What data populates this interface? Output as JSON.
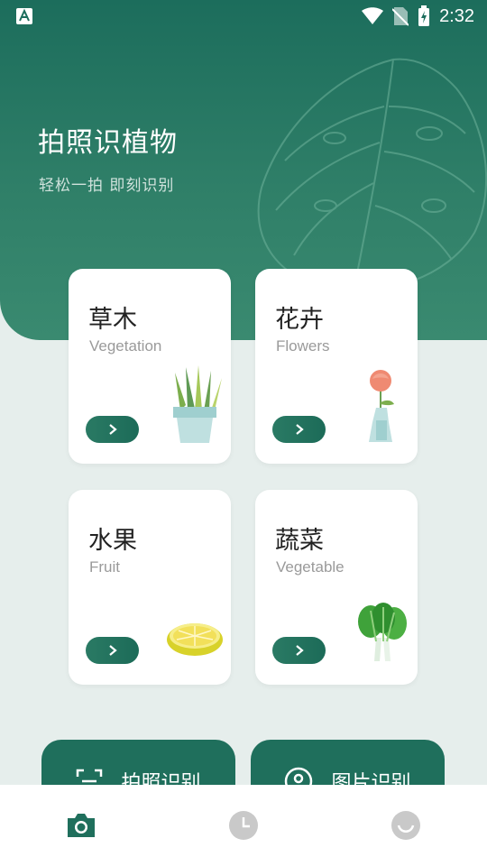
{
  "status_bar": {
    "time": "2:32"
  },
  "hero": {
    "title": "拍照识植物",
    "subtitle": "轻松一拍 即刻识别"
  },
  "categories": [
    {
      "title": "草木",
      "subtitle": "Vegetation",
      "icon": "potted-plant-icon"
    },
    {
      "title": "花卉",
      "subtitle": "Flowers",
      "icon": "flower-vase-icon"
    },
    {
      "title": "水果",
      "subtitle": "Fruit",
      "icon": "lemon-icon"
    },
    {
      "title": "蔬菜",
      "subtitle": "Vegetable",
      "icon": "bok-choy-icon"
    }
  ],
  "actions": [
    {
      "label": "拍照识别",
      "icon": "scan-icon"
    },
    {
      "label": "图片识别",
      "icon": "image-pin-icon"
    }
  ],
  "tabs": [
    {
      "name": "camera",
      "icon": "camera-icon",
      "active": true
    },
    {
      "name": "history",
      "icon": "clock-icon",
      "active": false
    },
    {
      "name": "profile",
      "icon": "smiley-icon",
      "active": false
    }
  ],
  "colors": {
    "primary": "#1f6f5c",
    "background": "#e6eeec",
    "inactive_tab": "#c9c9c9"
  }
}
